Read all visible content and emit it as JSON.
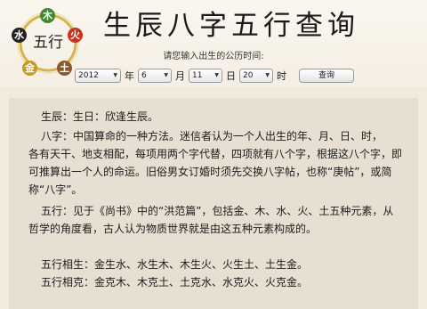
{
  "header": {
    "title": "生辰八字五行查询",
    "badge": {
      "center": "五行",
      "wood": "木",
      "fire": "火",
      "earth": "土",
      "metal": "金",
      "water": "水",
      "colors": {
        "wood": "#3f8a2a",
        "fire": "#c8331e",
        "earth": "#8a5a2b",
        "metal": "#c79a1c",
        "water": "#222222"
      }
    }
  },
  "form": {
    "prompt": "请您输入出生的公历时间:",
    "year_value": "2012",
    "year_unit": "年",
    "month_value": "6",
    "month_unit": "月",
    "day_value": "11",
    "day_unit": "日",
    "hour_value": "20",
    "hour_unit": "时",
    "query_label": "查询"
  },
  "result": {
    "line1": "生辰：生日：欣逢生辰。",
    "bazi_p1": "八字：中国算命的一种方法。迷信者认为一个人出生的年、月、日、时，",
    "bazi_p2": "各有天干、地支相配，每项用两个字代替，四项就有八个字，根据这八个字，即",
    "bazi_p3": "可推算出一个人的命运。旧俗男女订婚时须先交换八字帖，也称“庚帖”，或简",
    "bazi_p4": "称“八字”。",
    "wuxing_p1": "五行：见于《尚书》中的“洪范篇”，包括金、木、水、火、土五种元素，从",
    "wuxing_p2": "哲学的角度看，古人认为物质世界就是由这五种元素构成的。",
    "sheng": "五行相生：金生水、水生木、木生火、火生土、土生金。",
    "ke": "五行相克：金克木、木克土、土克水、水克火、火克金。"
  }
}
